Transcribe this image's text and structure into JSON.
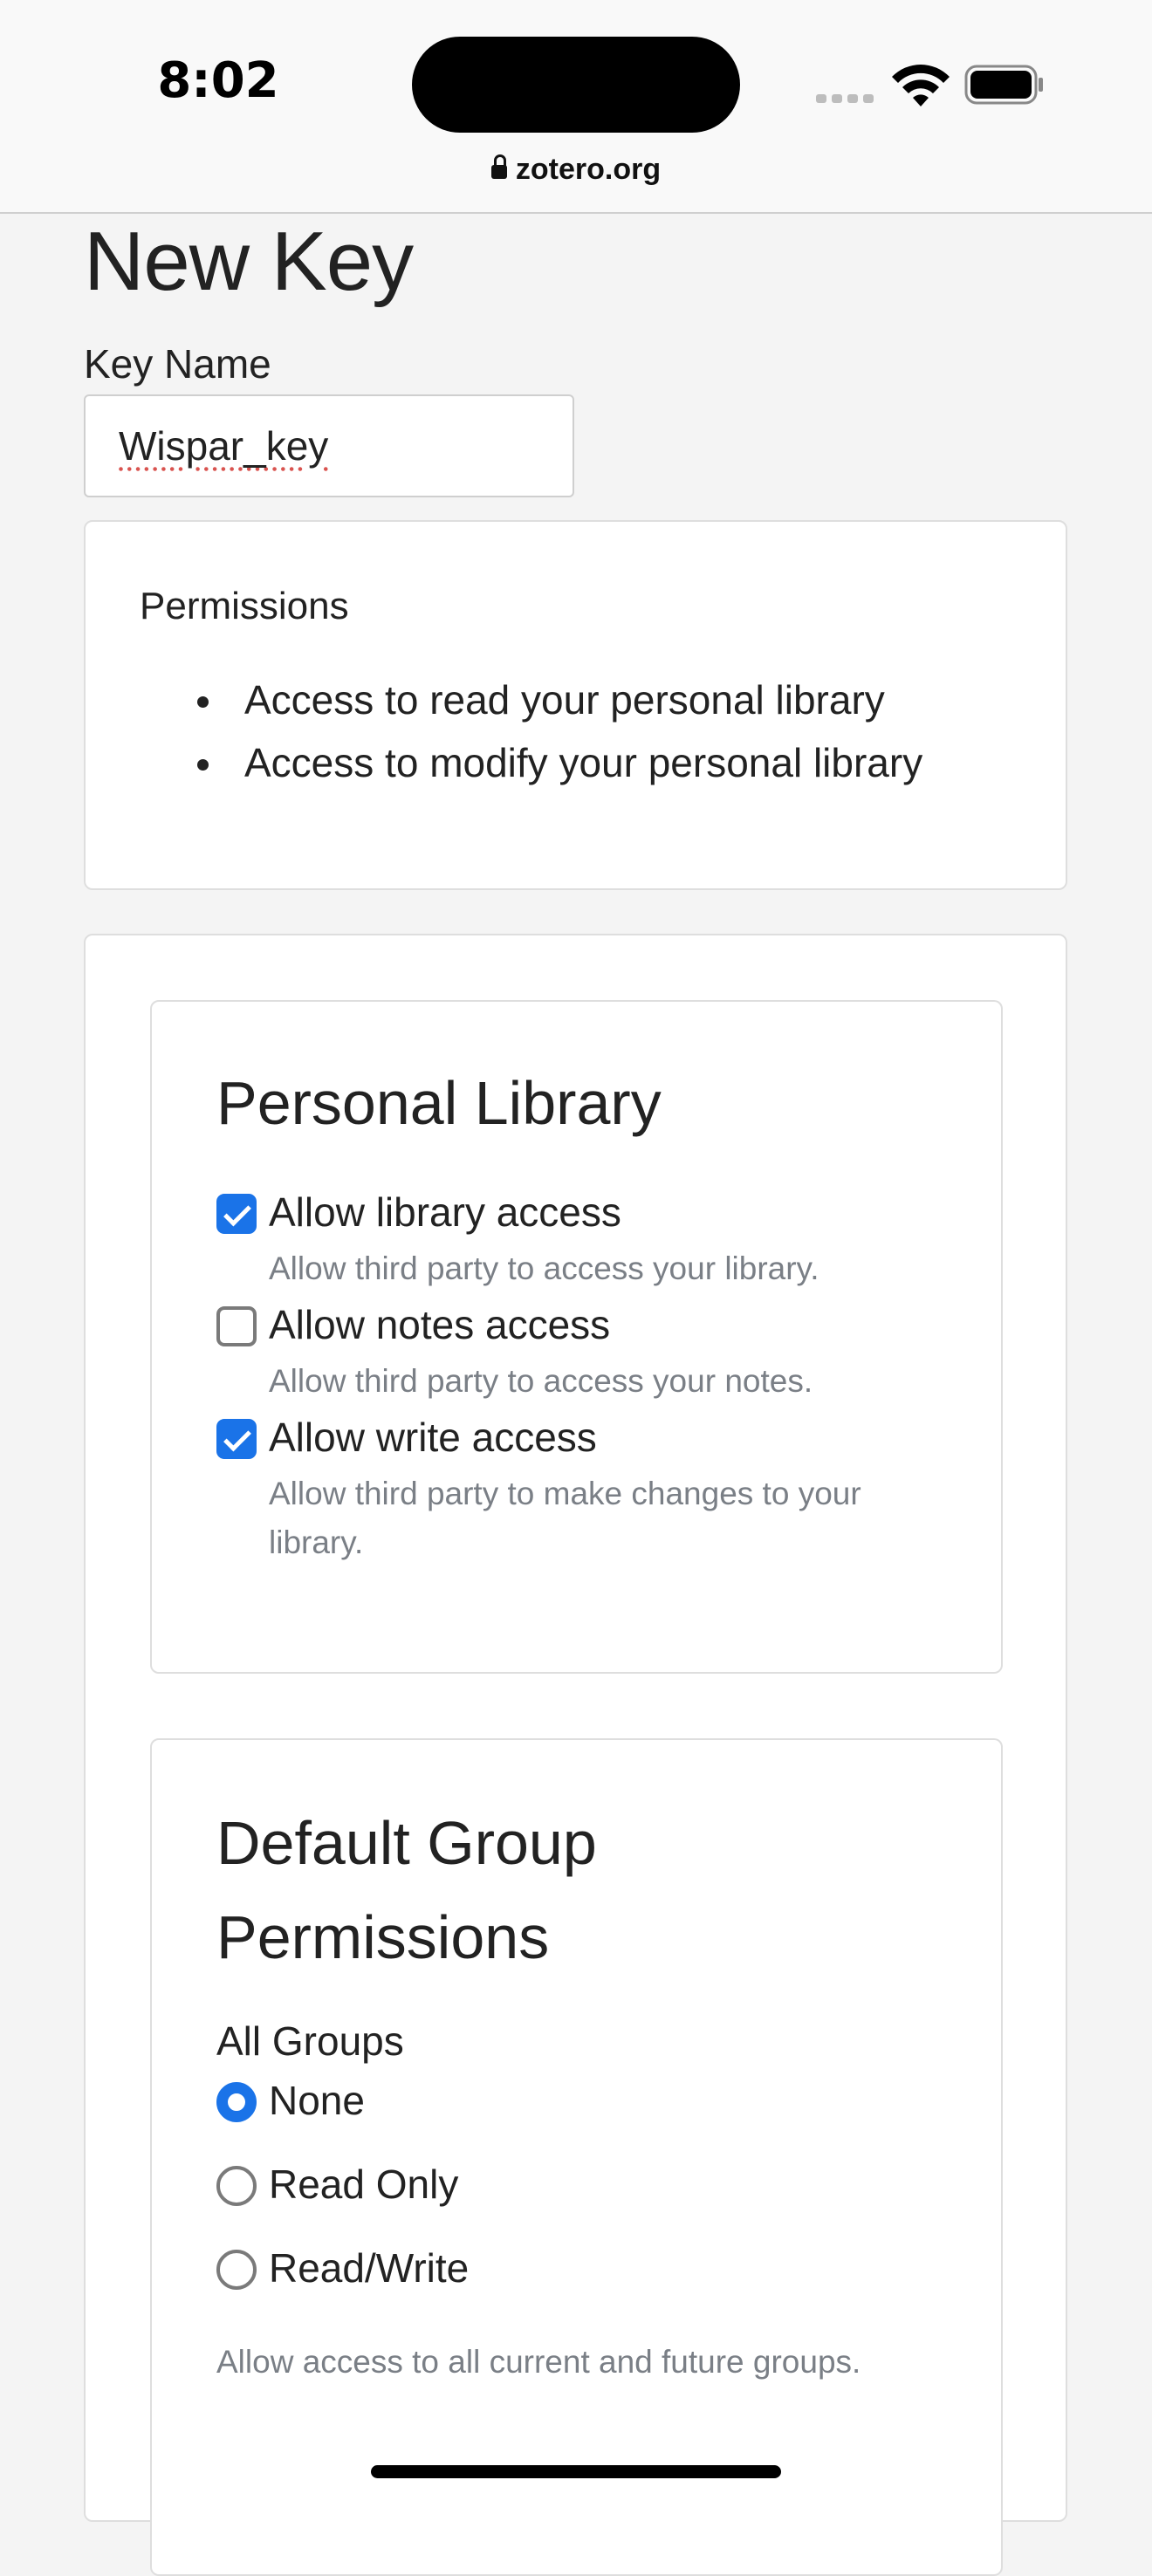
{
  "status_bar": {
    "time": "8:02",
    "url": "zotero.org"
  },
  "page": {
    "title": "New Key",
    "key_name_label": "Key Name",
    "key_name_value": "Wispar_key"
  },
  "permissions": {
    "title": "Permissions",
    "items": [
      "Access to read your personal library",
      "Access to modify your personal library"
    ]
  },
  "personal_library": {
    "title": "Personal Library",
    "options": [
      {
        "label": "Allow library access",
        "help": "Allow third party to access your library.",
        "checked": true
      },
      {
        "label": "Allow notes access",
        "help": "Allow third party to access your notes.",
        "checked": false
      },
      {
        "label": "Allow write access",
        "help": "Allow third party to make changes to your library.",
        "checked": true
      }
    ]
  },
  "default_group": {
    "title_line1": "Default Group",
    "title_line2": "Permissions",
    "groups_label": "All Groups",
    "options": [
      {
        "label": "None",
        "selected": true
      },
      {
        "label": "Read Only",
        "selected": false
      },
      {
        "label": "Read/Write",
        "selected": false
      }
    ],
    "help": "Allow access to all current and future groups."
  },
  "colors": {
    "accent": "#1a73e8",
    "muted_text": "#7a7f86"
  }
}
